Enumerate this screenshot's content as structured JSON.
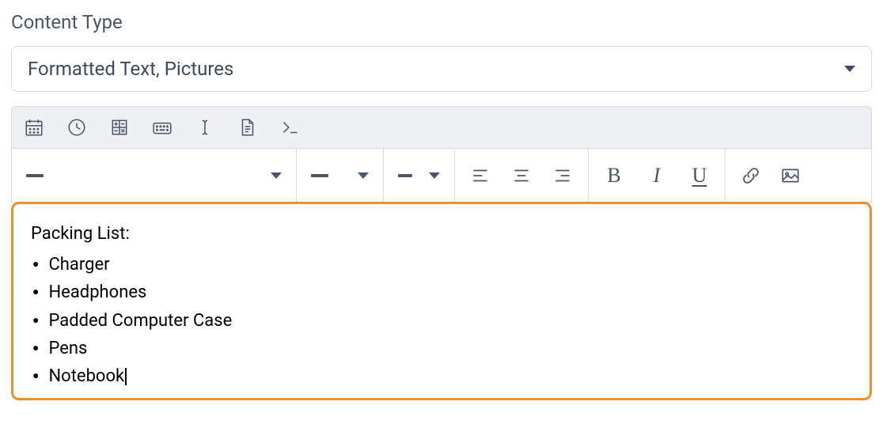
{
  "field": {
    "label": "Content Type"
  },
  "select": {
    "value": "Formatted Text, Pictures"
  },
  "editor": {
    "title": "Packing List:",
    "items": [
      "Charger",
      "Headphones",
      "Padded Computer Case",
      "Pens",
      "Notebook"
    ]
  }
}
